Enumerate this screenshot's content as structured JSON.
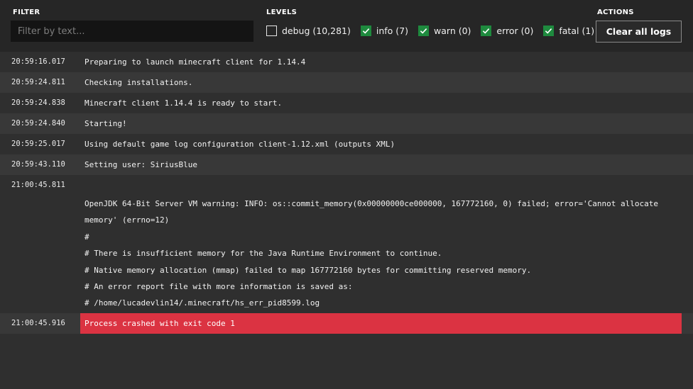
{
  "filter": {
    "title": "FILTER",
    "placeholder": "Filter by text...",
    "value": ""
  },
  "levels": {
    "title": "LEVELS",
    "items": [
      {
        "label": "debug (10,281)",
        "checked": false
      },
      {
        "label": "info (7)",
        "checked": true
      },
      {
        "label": "warn (0)",
        "checked": true
      },
      {
        "label": "error (0)",
        "checked": true
      },
      {
        "label": "fatal (1)",
        "checked": true
      }
    ]
  },
  "actions": {
    "title": "ACTIONS",
    "clear_label": "Clear all logs"
  },
  "colors": {
    "checkbox_on": "#1e8a3e",
    "fatal_row": "#db3342"
  },
  "logs": [
    {
      "time": "20:59:16.017",
      "message": "Preparing to launch minecraft client for 1.14.4"
    },
    {
      "time": "20:59:24.811",
      "message": "Checking installations."
    },
    {
      "time": "20:59:24.838",
      "message": "Minecraft client 1.14.4 is ready to start."
    },
    {
      "time": "20:59:24.840",
      "message": "Starting!"
    },
    {
      "time": "20:59:25.017",
      "message": "Using default game log configuration client-1.12.xml (outputs XML)"
    },
    {
      "time": "20:59:43.110",
      "message": "Setting user: SiriusBlue"
    },
    {
      "time": "21:00:45.811",
      "lines": [
        "OpenJDK 64-Bit Server VM warning: INFO: os::commit_memory(0x00000000ce000000, 167772160, 0) failed; error='Cannot allocate",
        "memory' (errno=12)",
        "#",
        "# There is insufficient memory for the Java Runtime Environment to continue.",
        "# Native memory allocation (mmap) failed to map 167772160 bytes for committing reserved memory.",
        "# An error report file with more information is saved as:",
        "# /home/lucadevlin14/.minecraft/hs_err_pid8599.log"
      ]
    },
    {
      "time": "21:00:45.916",
      "message": "Process crashed with exit code 1",
      "fatal": true
    }
  ]
}
